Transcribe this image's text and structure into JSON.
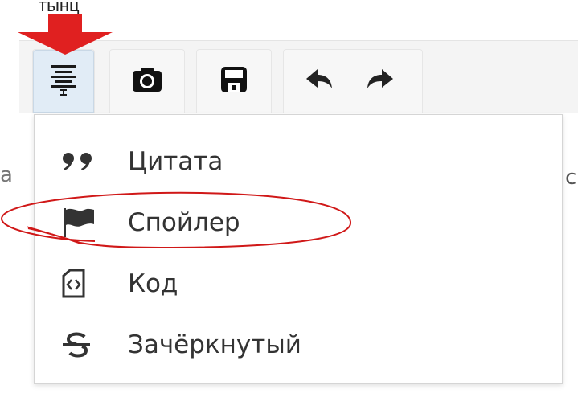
{
  "annotation": {
    "label": "тынц",
    "arrow_color": "#e02020",
    "ellipse_color": "#d01818"
  },
  "background": {
    "left_fragment": "a",
    "right_fragment": "c"
  },
  "toolbar": {
    "buttons": [
      {
        "name": "insert-block",
        "icon": "insert-block-icon",
        "active": true
      },
      {
        "name": "camera",
        "icon": "camera-icon"
      },
      {
        "name": "save",
        "icon": "save-icon"
      },
      {
        "name": "undo",
        "icon": "undo-icon"
      },
      {
        "name": "redo",
        "icon": "redo-icon"
      }
    ]
  },
  "menu": {
    "items": [
      {
        "label": "Цитата",
        "icon": "quote-icon"
      },
      {
        "label": "Спойлер",
        "icon": "flag-icon",
        "highlighted": true
      },
      {
        "label": "Код",
        "icon": "code-file-icon"
      },
      {
        "label": "Зачёркнутый",
        "icon": "strikethrough-icon"
      }
    ]
  }
}
